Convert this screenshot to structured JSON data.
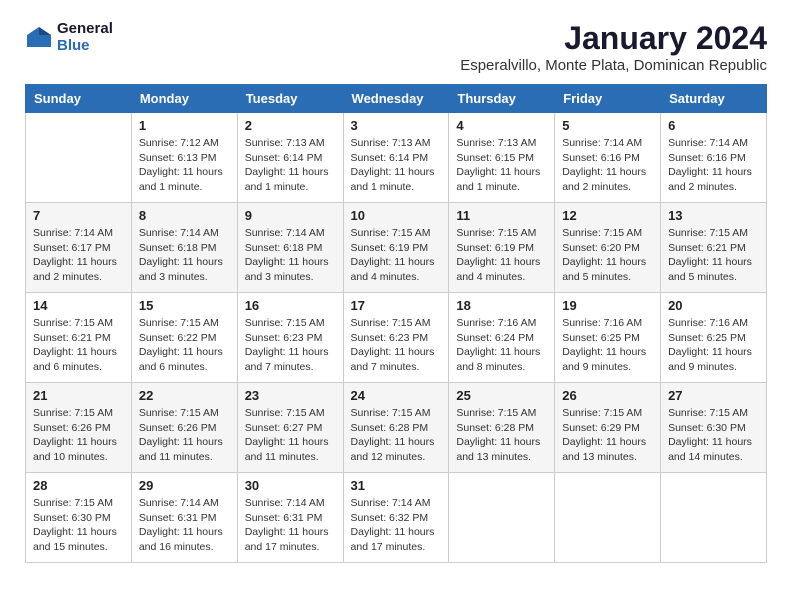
{
  "logo": {
    "line1": "General",
    "line2": "Blue"
  },
  "title": "January 2024",
  "subtitle": "Esperalvillo, Monte Plata, Dominican Republic",
  "days_of_week": [
    "Sunday",
    "Monday",
    "Tuesday",
    "Wednesday",
    "Thursday",
    "Friday",
    "Saturday"
  ],
  "weeks": [
    [
      {
        "day": "",
        "info": ""
      },
      {
        "day": "1",
        "info": "Sunrise: 7:12 AM\nSunset: 6:13 PM\nDaylight: 11 hours and 1 minute."
      },
      {
        "day": "2",
        "info": "Sunrise: 7:13 AM\nSunset: 6:14 PM\nDaylight: 11 hours and 1 minute."
      },
      {
        "day": "3",
        "info": "Sunrise: 7:13 AM\nSunset: 6:14 PM\nDaylight: 11 hours and 1 minute."
      },
      {
        "day": "4",
        "info": "Sunrise: 7:13 AM\nSunset: 6:15 PM\nDaylight: 11 hours and 1 minute."
      },
      {
        "day": "5",
        "info": "Sunrise: 7:14 AM\nSunset: 6:16 PM\nDaylight: 11 hours and 2 minutes."
      },
      {
        "day": "6",
        "info": "Sunrise: 7:14 AM\nSunset: 6:16 PM\nDaylight: 11 hours and 2 minutes."
      }
    ],
    [
      {
        "day": "7",
        "info": "Sunrise: 7:14 AM\nSunset: 6:17 PM\nDaylight: 11 hours and 2 minutes."
      },
      {
        "day": "8",
        "info": "Sunrise: 7:14 AM\nSunset: 6:18 PM\nDaylight: 11 hours and 3 minutes."
      },
      {
        "day": "9",
        "info": "Sunrise: 7:14 AM\nSunset: 6:18 PM\nDaylight: 11 hours and 3 minutes."
      },
      {
        "day": "10",
        "info": "Sunrise: 7:15 AM\nSunset: 6:19 PM\nDaylight: 11 hours and 4 minutes."
      },
      {
        "day": "11",
        "info": "Sunrise: 7:15 AM\nSunset: 6:19 PM\nDaylight: 11 hours and 4 minutes."
      },
      {
        "day": "12",
        "info": "Sunrise: 7:15 AM\nSunset: 6:20 PM\nDaylight: 11 hours and 5 minutes."
      },
      {
        "day": "13",
        "info": "Sunrise: 7:15 AM\nSunset: 6:21 PM\nDaylight: 11 hours and 5 minutes."
      }
    ],
    [
      {
        "day": "14",
        "info": "Sunrise: 7:15 AM\nSunset: 6:21 PM\nDaylight: 11 hours and 6 minutes."
      },
      {
        "day": "15",
        "info": "Sunrise: 7:15 AM\nSunset: 6:22 PM\nDaylight: 11 hours and 6 minutes."
      },
      {
        "day": "16",
        "info": "Sunrise: 7:15 AM\nSunset: 6:23 PM\nDaylight: 11 hours and 7 minutes."
      },
      {
        "day": "17",
        "info": "Sunrise: 7:15 AM\nSunset: 6:23 PM\nDaylight: 11 hours and 7 minutes."
      },
      {
        "day": "18",
        "info": "Sunrise: 7:16 AM\nSunset: 6:24 PM\nDaylight: 11 hours and 8 minutes."
      },
      {
        "day": "19",
        "info": "Sunrise: 7:16 AM\nSunset: 6:25 PM\nDaylight: 11 hours and 9 minutes."
      },
      {
        "day": "20",
        "info": "Sunrise: 7:16 AM\nSunset: 6:25 PM\nDaylight: 11 hours and 9 minutes."
      }
    ],
    [
      {
        "day": "21",
        "info": "Sunrise: 7:15 AM\nSunset: 6:26 PM\nDaylight: 11 hours and 10 minutes."
      },
      {
        "day": "22",
        "info": "Sunrise: 7:15 AM\nSunset: 6:26 PM\nDaylight: 11 hours and 11 minutes."
      },
      {
        "day": "23",
        "info": "Sunrise: 7:15 AM\nSunset: 6:27 PM\nDaylight: 11 hours and 11 minutes."
      },
      {
        "day": "24",
        "info": "Sunrise: 7:15 AM\nSunset: 6:28 PM\nDaylight: 11 hours and 12 minutes."
      },
      {
        "day": "25",
        "info": "Sunrise: 7:15 AM\nSunset: 6:28 PM\nDaylight: 11 hours and 13 minutes."
      },
      {
        "day": "26",
        "info": "Sunrise: 7:15 AM\nSunset: 6:29 PM\nDaylight: 11 hours and 13 minutes."
      },
      {
        "day": "27",
        "info": "Sunrise: 7:15 AM\nSunset: 6:30 PM\nDaylight: 11 hours and 14 minutes."
      }
    ],
    [
      {
        "day": "28",
        "info": "Sunrise: 7:15 AM\nSunset: 6:30 PM\nDaylight: 11 hours and 15 minutes."
      },
      {
        "day": "29",
        "info": "Sunrise: 7:14 AM\nSunset: 6:31 PM\nDaylight: 11 hours and 16 minutes."
      },
      {
        "day": "30",
        "info": "Sunrise: 7:14 AM\nSunset: 6:31 PM\nDaylight: 11 hours and 17 minutes."
      },
      {
        "day": "31",
        "info": "Sunrise: 7:14 AM\nSunset: 6:32 PM\nDaylight: 11 hours and 17 minutes."
      },
      {
        "day": "",
        "info": ""
      },
      {
        "day": "",
        "info": ""
      },
      {
        "day": "",
        "info": ""
      }
    ]
  ]
}
